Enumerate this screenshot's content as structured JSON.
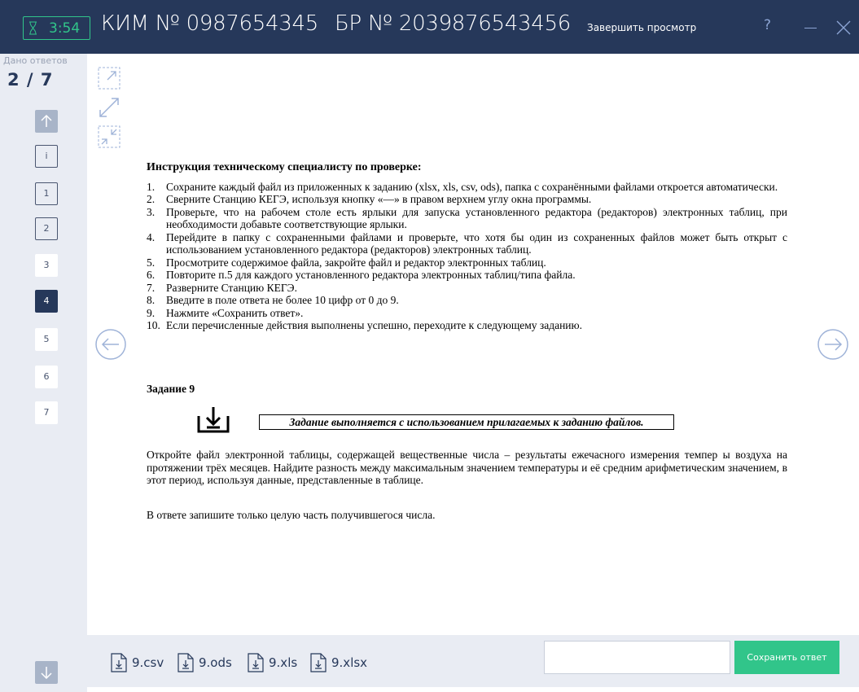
{
  "header": {
    "timer": "3:54",
    "kim": "КИМ № 0987654345",
    "br": "БР № 2039876543456",
    "finish_label": "Завершить просмотр",
    "help_label": "?"
  },
  "sidebar": {
    "given_label": "Дано ответов",
    "given_value": "2 / 7",
    "items": [
      {
        "label": "i",
        "style": "outline"
      },
      {
        "label": "1",
        "style": "outline"
      },
      {
        "label": "2",
        "style": "outline"
      },
      {
        "label": "3",
        "style": "plain"
      },
      {
        "label": "4",
        "style": "active"
      },
      {
        "label": "5",
        "style": "plain"
      },
      {
        "label": "6",
        "style": "plain"
      },
      {
        "label": "7",
        "style": "plain"
      }
    ]
  },
  "doc": {
    "instr_title": "Инструкция техническому специалисту по проверке:",
    "steps": [
      {
        "n": "1.",
        "text": "Сохраните каждый файл из приложенных к заданию (xlsx, xls, csv, ods), папка с сохранёнными файлами откроется автоматически."
      },
      {
        "n": "2.",
        "text": "Сверните Станцию КЕГЭ, используя кнопку «—» в правом верхнем углу окна программы."
      },
      {
        "n": "3.",
        "text": "Проверьте, что на рабочем столе есть ярлыки для запуска установленного редактора (редакторов) электронных таблиц, при необходимости добавьте соответствующие ярлыки."
      },
      {
        "n": "4.",
        "text": "Перейдите в папку с сохраненными файлами и проверьте, что хотя бы один из сохраненных файлов может быть открыт с использованием установленного редактора (редакторов) электронных таблиц."
      },
      {
        "n": "5.",
        "text": "Просмотрите содержимое файла, закройте файл и редактор электронных таблиц."
      },
      {
        "n": "6.",
        "text": "Повторите п.5 для каждого установленного редактора электронных таблиц/типа файла."
      },
      {
        "n": "7.",
        "text": "Разверните Станцию КЕГЭ."
      },
      {
        "n": "8.",
        "text": "Введите в поле ответа не более 10 цифр от 0 до 9."
      },
      {
        "n": "9.",
        "text": "Нажмите «Сохранить ответ»."
      },
      {
        "n": "10.",
        "text": "Если перечисленные действия выполнены успешно, переходите к следующему заданию."
      }
    ],
    "task_title": "Задание 9",
    "task_note": "Задание выполняется с использованием прилагаемых к заданию файлов.",
    "task_text": "Откройте файл электронной таблицы, содержащей вещественные числа – результаты ежечасного измерения темпер       ы воздуха на протяжении трёх месяцев. Найдите разность между максимальным значением температуры и её средним арифметическим значением, в этот период, используя данные, представленные в таблице.",
    "answer_note": "В ответе запишите только целую часть получившегося числа."
  },
  "files": [
    "9.csv",
    "9.ods",
    "9.xls",
    "9.xlsx"
  ],
  "answer": {
    "value": "",
    "save_label": "Сохранить ответ"
  },
  "colors": {
    "header_bg": "#26385a",
    "accent": "#31c58a",
    "panel_bg": "#e9ecf3"
  }
}
